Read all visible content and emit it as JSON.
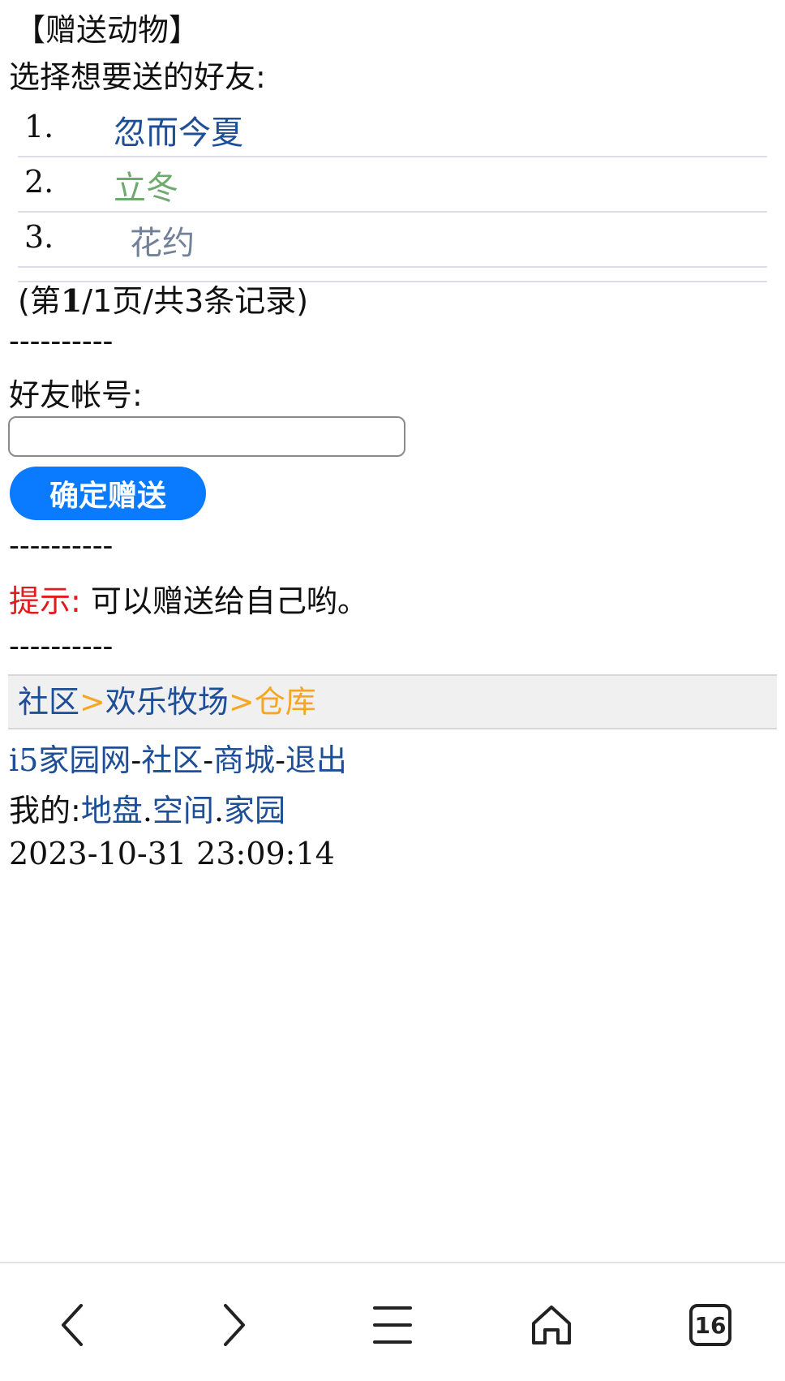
{
  "page": {
    "title": "【赠送动物】",
    "choose_label": "选择想要送的好友:"
  },
  "friends": [
    {
      "index": "1.",
      "name": "忽而今夏"
    },
    {
      "index": "2.",
      "name": "立冬"
    },
    {
      "index": "3.",
      "name": "花约"
    }
  ],
  "pager": {
    "prefix": "(第",
    "current": "1",
    "rest": "/1页/共3条记录)"
  },
  "divider": "----------",
  "form": {
    "account_label": "好友帐号:",
    "account_value": "",
    "submit_label": "确定赠送"
  },
  "tip": {
    "label": "提示:",
    "text": " 可以赠送给自己哟。"
  },
  "breadcrumb": {
    "items": [
      "社区",
      "欢乐牧场",
      "仓库"
    ],
    "separator": ">"
  },
  "footer": {
    "site": "i5家园网",
    "community": "社区",
    "mall": "商城",
    "logout": "退出",
    "dash": "-",
    "mine_label": "我的:",
    "mine_links": [
      "地盘",
      "空间",
      "家园"
    ],
    "dot": ".",
    "timestamp": "2023-10-31 23:09:14"
  },
  "browser_bar": {
    "back_icon": "chevron-left-icon",
    "forward_icon": "chevron-right-icon",
    "menu_icon": "hamburger-menu-icon",
    "home_icon": "home-icon",
    "tabs_icon": "tabs-icon",
    "tab_count": "16"
  },
  "colors": {
    "link": "#1d4e96",
    "friend2": "#6eaa6e",
    "friend3": "#72819a",
    "tip_red": "#e01b1b",
    "crumb_orange": "#f5a623",
    "button_blue": "#0a7aff"
  }
}
